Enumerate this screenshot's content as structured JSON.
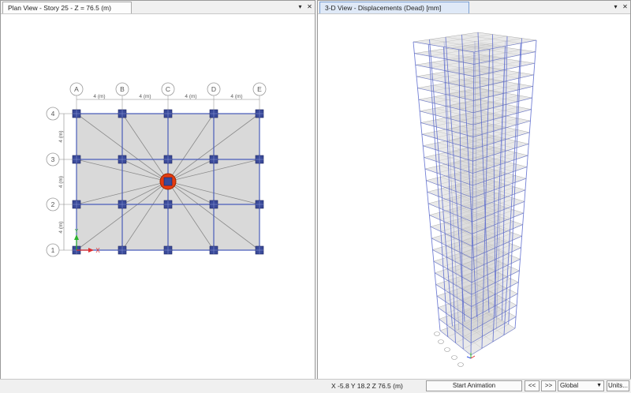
{
  "left_window": {
    "tab_title": "Plan View - Story 25 - Z = 76.5 (m)"
  },
  "right_window": {
    "tab_title": "3-D View  - Displacements (Dead)  [mm]"
  },
  "window_controls": {
    "menu": "▾",
    "close": "✕"
  },
  "plan": {
    "grid_columns": [
      "A",
      "B",
      "C",
      "D",
      "E"
    ],
    "grid_rows": [
      "4",
      "3",
      "2",
      "1"
    ],
    "column_spacing_labels": [
      "4 (m)",
      "4 (m)",
      "4 (m)",
      "4 (m)"
    ],
    "row_spacing_labels": [
      "4 (m)",
      "4 (m)",
      "4 (m)"
    ],
    "axis_x": "X",
    "axis_y": "Y",
    "colors": {
      "column": "#3a4a9a",
      "beam": "#4a5dbb",
      "slab": "#d9d9d9",
      "highlight": "#e53a10",
      "x_axis": "#e03030",
      "y_axis": "#2bb32b"
    }
  },
  "view3d": {
    "colors": {
      "frame": "#5a6acf",
      "floor": "#cfcfcf"
    }
  },
  "statusbar": {
    "coords": "X -5.8  Y 18.2  Z 76.5 (m)",
    "start_animation": "Start Animation",
    "prev": "<<",
    "next": ">>",
    "coord_system": "Global",
    "units": "Units..."
  }
}
